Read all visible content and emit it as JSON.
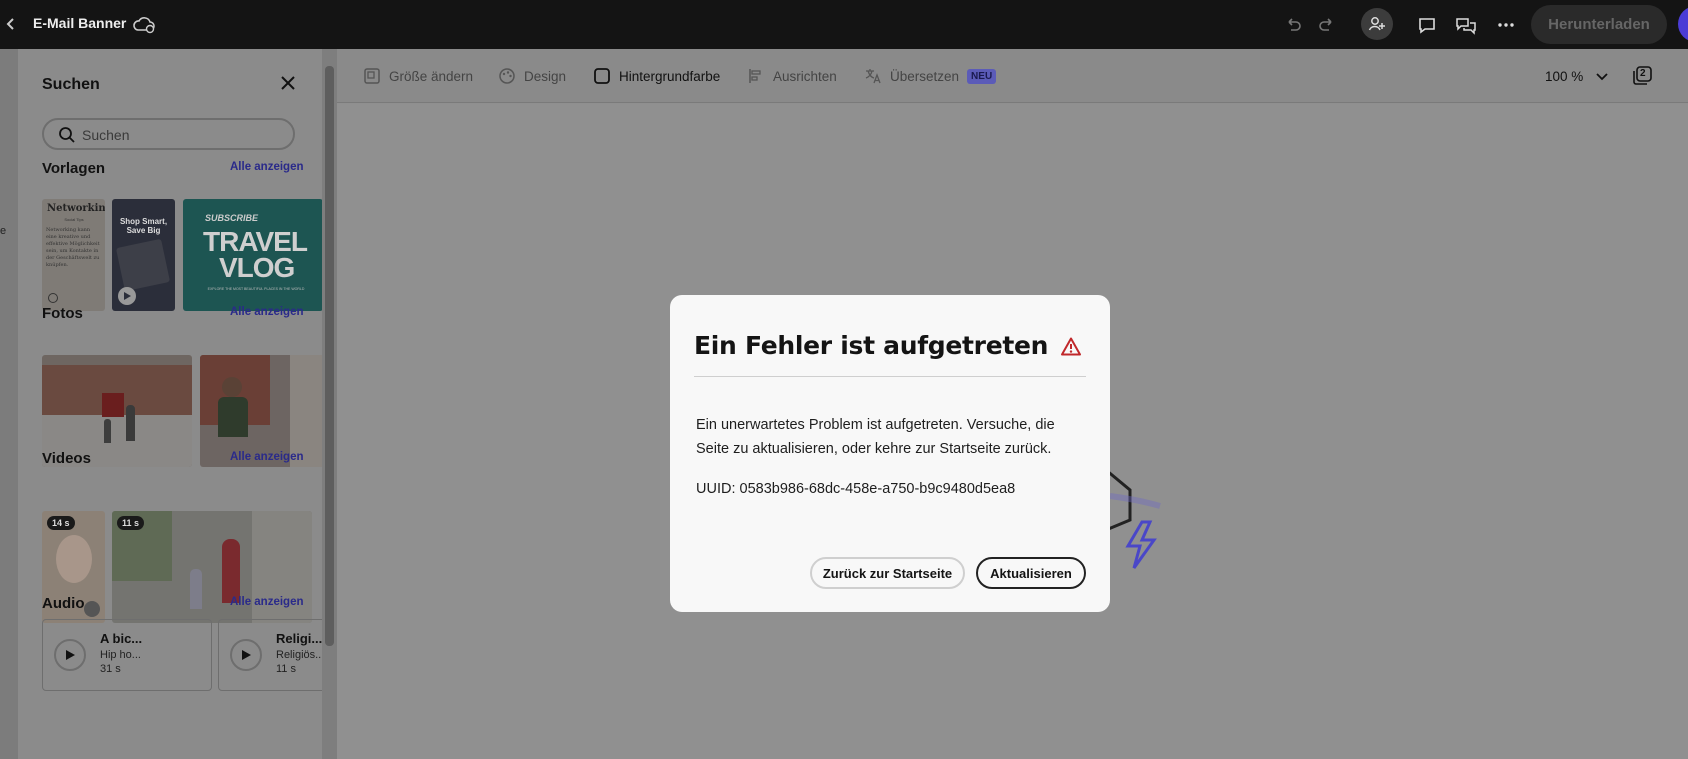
{
  "topbar": {
    "title": "E-Mail Banner",
    "download_label": "Herunterladen",
    "icons": [
      "back-chevron-icon",
      "cloud-sync-icon",
      "undo-icon",
      "redo-icon",
      "invite-user-icon",
      "comment-icon",
      "share-review-icon",
      "more-icon"
    ]
  },
  "rail": {
    "partial_text": "e"
  },
  "panel": {
    "title": "Suchen",
    "search_placeholder": "Suchen",
    "sections": {
      "templates": {
        "title": "Vorlagen",
        "link": "Alle anzeigen"
      },
      "photos": {
        "title": "Fotos",
        "link": "Alle anzeigen"
      },
      "videos": {
        "title": "Videos",
        "link": "Alle anzeigen"
      },
      "audio": {
        "title": "Audio",
        "link": "Alle anzeigen"
      }
    },
    "templates": {
      "t1_title": "Networking",
      "t1_subtitle": "Social Tips",
      "t1_body": "Networking kann eine kreative und effektive Möglichkeit sein, um Kontakte in der Geschäftswelt zu knüpfen.",
      "t2_text": "Shop Smart, Save Big",
      "t3_top": "SUBSCRIBE",
      "t3_main1": "TRAVEL",
      "t3_main2": "VLOG",
      "t3_bottom": "EXPLORE THE MOST BEAUTIFUL PLACES IN THE WORLD"
    },
    "videos": [
      {
        "badge": "14 s"
      },
      {
        "badge": "11 s"
      }
    ],
    "audio": [
      {
        "title": "A bic...",
        "subtitle": "Hip ho...",
        "duration": "31 s"
      },
      {
        "title": "Religi...",
        "subtitle": "Religiös...",
        "duration": "11 s"
      }
    ]
  },
  "toolbar": {
    "resize": "Größe ändern",
    "design": "Design",
    "background": "Hintergrundfarbe",
    "align": "Ausrichten",
    "translate": "Übersetzen",
    "new_badge": "NEU",
    "zoom": "100 %",
    "pages_count": "2"
  },
  "modal": {
    "title": "Ein Fehler ist aufgetreten",
    "body": "Ein unerwartetes Problem ist aufgetreten. Versuche, die Seite zu aktualisieren, oder kehre zur Startseite zurück.",
    "uuid": "UUID: 0583b986-68dc-458e-a750-b9c9480d5ea8",
    "home_button": "Zurück zur Startseite",
    "refresh_button": "Aktualisieren"
  },
  "colors": {
    "topbar": "#141414",
    "overlay": "#8f8f8f",
    "modal_bg": "#f8f8f8",
    "warning": "#c0282b",
    "accent": "#4b3cd6",
    "link": "#2a2a8a"
  }
}
